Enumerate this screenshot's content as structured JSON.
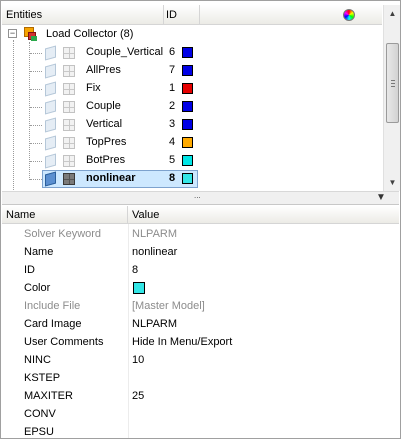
{
  "tree_header": {
    "entities_label": "Entities",
    "id_label": "ID",
    "color_icon": "color-wheel-icon"
  },
  "tree": {
    "root": {
      "label": "Load Collector (8)",
      "icon": "load-collector-icon",
      "expanded": true
    },
    "items": [
      {
        "label": "Couple_Vertical",
        "id": "6",
        "color": "#0000e6",
        "selected": false
      },
      {
        "label": "AllPres",
        "id": "7",
        "color": "#0000e6",
        "selected": false
      },
      {
        "label": "Fix",
        "id": "1",
        "color": "#e60000",
        "selected": false
      },
      {
        "label": "Couple",
        "id": "2",
        "color": "#0000e6",
        "selected": false
      },
      {
        "label": "Vertical",
        "id": "3",
        "color": "#0000e6",
        "selected": false
      },
      {
        "label": "TopPres",
        "id": "4",
        "color": "#ffaa00",
        "selected": false
      },
      {
        "label": "BotPres",
        "id": "5",
        "color": "#00e6e6",
        "selected": false
      },
      {
        "label": "nonlinear",
        "id": "8",
        "color": "#33e6e6",
        "selected": true
      }
    ]
  },
  "splitter": {
    "grip": "...",
    "menu_icon": "dropdown-arrow-icon"
  },
  "properties_header": {
    "name_label": "Name",
    "value_label": "Value"
  },
  "properties": [
    {
      "name": "Solver Keyword",
      "value": "NLPARM",
      "readonly": true
    },
    {
      "name": "Name",
      "value": "nonlinear",
      "readonly": false
    },
    {
      "name": "ID",
      "value": "8",
      "readonly": false
    },
    {
      "name": "Color",
      "value": "",
      "color": "#33e6e6",
      "readonly": false
    },
    {
      "name": "Include File",
      "value": "[Master Model]",
      "readonly": true
    },
    {
      "name": "Card Image",
      "value": "NLPARM",
      "readonly": false
    },
    {
      "name": "User Comments",
      "value": "Hide In Menu/Export",
      "readonly": false
    },
    {
      "name": "NINC",
      "value": "10",
      "readonly": false
    },
    {
      "name": "KSTEP",
      "value": "",
      "readonly": false
    },
    {
      "name": "MAXITER",
      "value": "25",
      "readonly": false
    },
    {
      "name": "CONV",
      "value": "",
      "readonly": false
    },
    {
      "name": "EPSU",
      "value": "",
      "readonly": false
    }
  ]
}
